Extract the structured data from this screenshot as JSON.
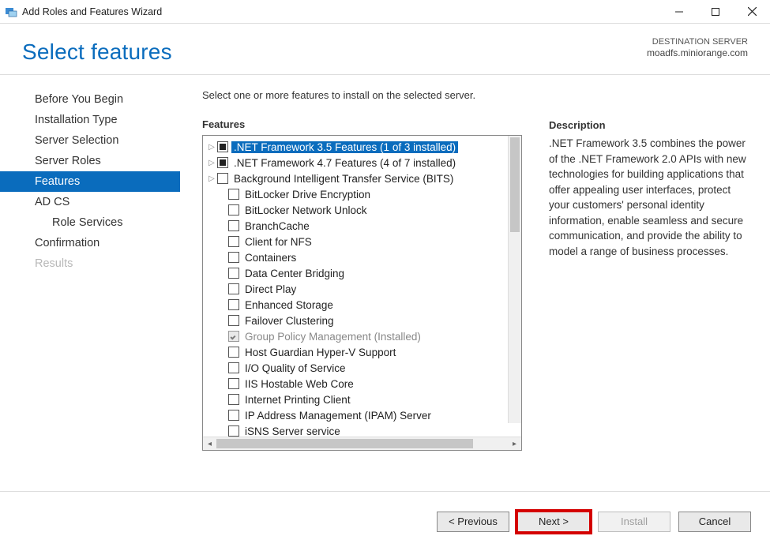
{
  "window": {
    "title": "Add Roles and Features Wizard"
  },
  "header": {
    "page_title": "Select features",
    "destination_label": "DESTINATION SERVER",
    "destination_server": "moadfs.miniorange.com"
  },
  "sidebar": {
    "items": [
      {
        "label": "Before You Begin",
        "state": "normal"
      },
      {
        "label": "Installation Type",
        "state": "normal"
      },
      {
        "label": "Server Selection",
        "state": "normal"
      },
      {
        "label": "Server Roles",
        "state": "normal"
      },
      {
        "label": "Features",
        "state": "active"
      },
      {
        "label": "AD CS",
        "state": "normal"
      },
      {
        "label": "Role Services",
        "state": "normal",
        "indent": true
      },
      {
        "label": "Confirmation",
        "state": "normal"
      },
      {
        "label": "Results",
        "state": "disabled"
      }
    ]
  },
  "content": {
    "intro": "Select one or more features to install on the selected server.",
    "features_heading": "Features",
    "features": [
      {
        "label": ".NET Framework 3.5 Features (1 of 3 installed)",
        "check": "partial",
        "expandable": true,
        "selected": true
      },
      {
        "label": ".NET Framework 4.7 Features (4 of 7 installed)",
        "check": "partial",
        "expandable": true
      },
      {
        "label": "Background Intelligent Transfer Service (BITS)",
        "check": "empty",
        "expandable": true
      },
      {
        "label": "BitLocker Drive Encryption",
        "check": "empty"
      },
      {
        "label": "BitLocker Network Unlock",
        "check": "empty"
      },
      {
        "label": "BranchCache",
        "check": "empty"
      },
      {
        "label": "Client for NFS",
        "check": "empty"
      },
      {
        "label": "Containers",
        "check": "empty"
      },
      {
        "label": "Data Center Bridging",
        "check": "empty"
      },
      {
        "label": "Direct Play",
        "check": "empty"
      },
      {
        "label": "Enhanced Storage",
        "check": "empty"
      },
      {
        "label": "Failover Clustering",
        "check": "empty"
      },
      {
        "label": "Group Policy Management (Installed)",
        "check": "installed",
        "installed": true
      },
      {
        "label": "Host Guardian Hyper-V Support",
        "check": "empty"
      },
      {
        "label": "I/O Quality of Service",
        "check": "empty"
      },
      {
        "label": "IIS Hostable Web Core",
        "check": "empty"
      },
      {
        "label": "Internet Printing Client",
        "check": "empty"
      },
      {
        "label": "IP Address Management (IPAM) Server",
        "check": "empty"
      },
      {
        "label": "iSNS Server service",
        "check": "empty"
      }
    ],
    "description_heading": "Description",
    "description_text": ".NET Framework 3.5 combines the power of the .NET Framework 2.0 APIs with new technologies for building applications that offer appealing user interfaces, protect your customers' personal identity information, enable seamless and secure communication, and provide the ability to model a range of business processes."
  },
  "footer": {
    "previous": "< Previous",
    "next": "Next >",
    "install": "Install",
    "cancel": "Cancel"
  }
}
